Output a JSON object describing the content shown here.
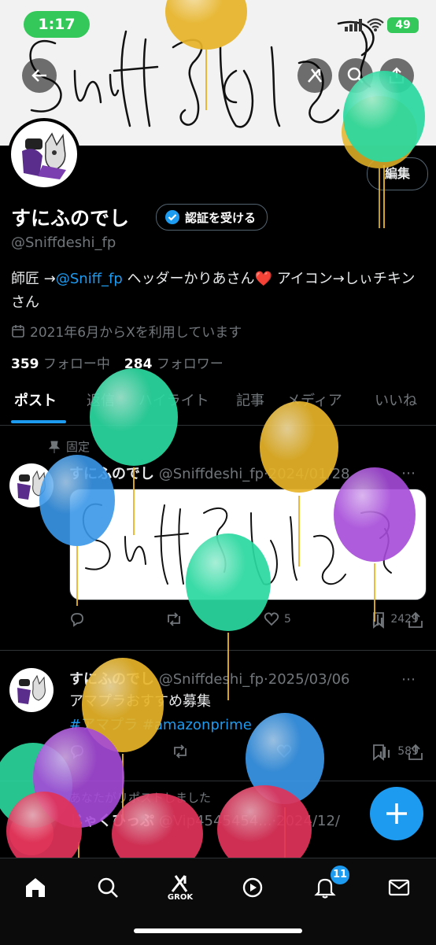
{
  "status_bar": {
    "time": "1:17",
    "battery": "49"
  },
  "header": {
    "banner_signature": "Sniffひのご"
  },
  "profile": {
    "display_name": "すにふのでし",
    "verify_label": "認証を受ける",
    "handle": "@Sniffdeshi_fp",
    "bio": {
      "prefix": "師匠 →",
      "mention": "@Sniff_fp",
      "middle": " ヘッダーかりあさん",
      "heart": "❤️",
      "suffix": " アイコン→しぃチキンさん"
    },
    "joined": "2021年6月からXを利用しています",
    "following_count": "359",
    "following_label": "フォロー中",
    "followers_count": "284",
    "followers_label": "フォロワー",
    "edit_label": "編集"
  },
  "tabs": [
    "ポスト",
    "返信",
    "ハイライト",
    "記事",
    "メディア",
    "いいね"
  ],
  "posts": [
    {
      "pinned_label": "固定",
      "name": "すにふのでし",
      "handle": "@Sniffdeshi_fp",
      "date": "2024/01/28",
      "likes": "5",
      "views": "2429"
    },
    {
      "name": "すにふのでし",
      "handle": "@Sniffdeshi_fp",
      "date": "2025/03/06",
      "text": "アマプラおすすめ募集",
      "hashtags": "#アマプラ #amazonprime",
      "views": "589"
    },
    {
      "repost_label": "あなたがリポストしました",
      "name": "じゃくひっぷ",
      "handle": "@Vip4545454...",
      "date": "2024/12/"
    }
  ],
  "nav": {
    "grok_label": "GROK",
    "notif_badge": "11"
  },
  "colors": {
    "accent": "#1d9bf0",
    "bg": "#000000",
    "balloon_green": "#2bd9a0",
    "balloon_yellow": "#e8b52a",
    "balloon_purple": "#a64bd9",
    "balloon_blue": "#3a97e8",
    "balloon_pink": "#e0335a"
  }
}
